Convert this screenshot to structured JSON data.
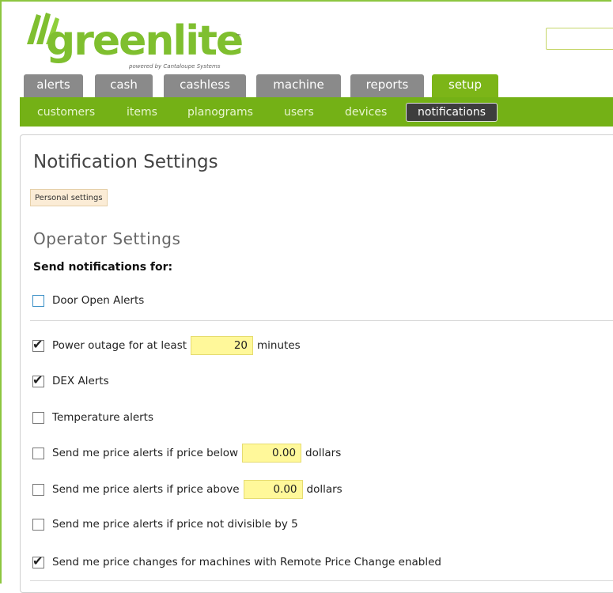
{
  "brand": {
    "name": "greenlite",
    "tm": "™",
    "sub": "powered by Cantaloupe Systems",
    "color": "#7fbf2f"
  },
  "tabs": [
    {
      "label": "alerts",
      "active": false
    },
    {
      "label": "cash",
      "active": false
    },
    {
      "label": "cashless",
      "active": false
    },
    {
      "label": "machine",
      "active": false
    },
    {
      "label": "reports",
      "active": false
    },
    {
      "label": "setup",
      "active": true
    }
  ],
  "subnav": [
    {
      "label": "customers",
      "active": false
    },
    {
      "label": "items",
      "active": false
    },
    {
      "label": "planograms",
      "active": false
    },
    {
      "label": "users",
      "active": false
    },
    {
      "label": "devices",
      "active": false
    },
    {
      "label": "notifications",
      "active": true
    }
  ],
  "page": {
    "title": "Notification Settings",
    "personal_button": "Personal settings",
    "section_title": "Operator Settings",
    "send_for": "Send notifications for:"
  },
  "options": {
    "door_open": {
      "label": "Door Open Alerts",
      "checked": false
    },
    "power_outage": {
      "label_before": "Power outage for at least",
      "value": "20",
      "label_after": "minutes",
      "checked": true
    },
    "dex": {
      "label": "DEX Alerts",
      "checked": true
    },
    "temperature": {
      "label": "Temperature alerts",
      "checked": false
    },
    "price_below": {
      "label_before": "Send me price alerts if price below",
      "value": "0.00",
      "label_after": "dollars",
      "checked": false
    },
    "price_above": {
      "label_before": "Send me price alerts if price above",
      "value": "0.00",
      "label_after": "dollars",
      "checked": false
    },
    "not_divisible": {
      "label": "Send me price alerts if price not divisible by 5",
      "checked": false
    },
    "remote_price": {
      "label": "Send me price changes for machines with Remote Price Change enabled",
      "checked": true
    }
  },
  "check_glyph": "✔"
}
